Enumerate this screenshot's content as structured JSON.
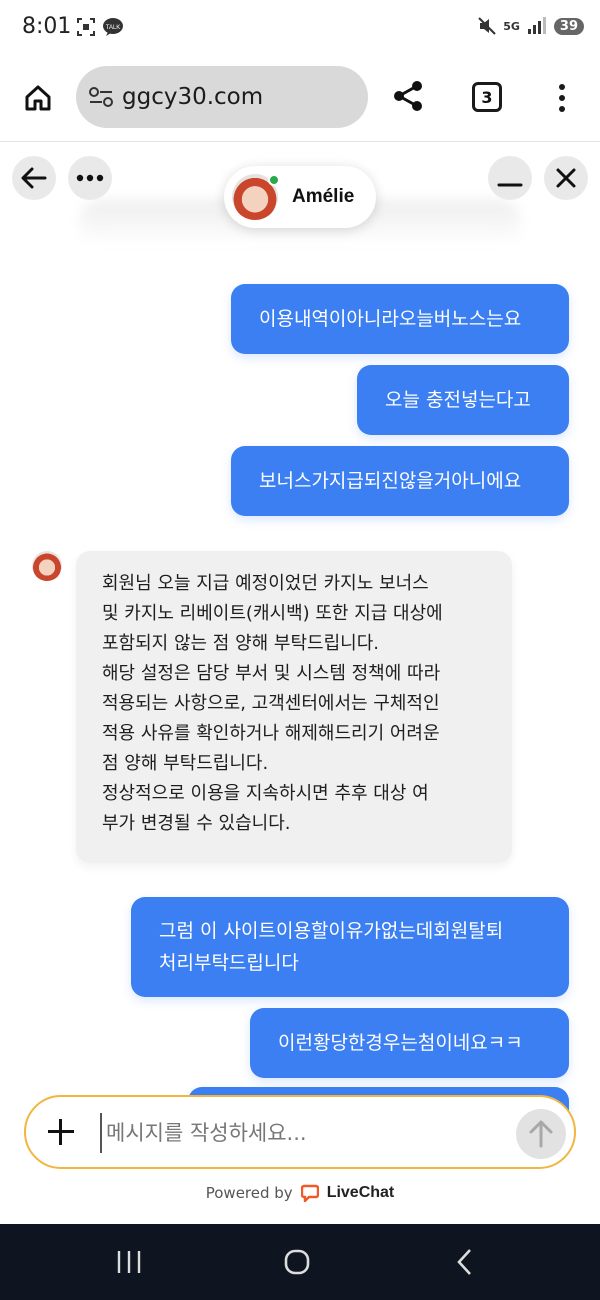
{
  "status_bar": {
    "time": "8:01",
    "battery": "39",
    "network": "5G"
  },
  "browser": {
    "url": "ggcy30.com",
    "tab_count": "3"
  },
  "chat": {
    "agent_name": "Amélie",
    "agent_status": "online",
    "messages": [
      {
        "from": "user",
        "text": "이용내역이아니라오늘버노스는요"
      },
      {
        "from": "user",
        "text": "오늘 충전넣는다고"
      },
      {
        "from": "user",
        "text": "보너스가지급되진않을거아니에요"
      },
      {
        "from": "agent",
        "text": "회원님 오늘 지급 예정이었던 카지노 보너스\n및 카지노 리베이트(캐시백) 또한 지급 대상에\n포함되지 않는 점 양해 부탁드립니다.\n해당 설정은 담당 부서 및 시스템 정책에 따라\n적용되는 사항으로, 고객센터에서는 구체적인\n적용 사유를 확인하거나 해제해드리기 어려운\n점 양해 부탁드립니다.\n정상적으로 이용을 지속하시면 추후 대상 여\n부가 변경될 수 있습니다."
      },
      {
        "from": "user",
        "text": "그럼 이 사이트이용할이유가없는데회원탈퇴\n처리부탁드립니다"
      },
      {
        "from": "user",
        "text": "이런황당한경우는첨이네요ㅋㅋ"
      }
    ]
  },
  "composer": {
    "placeholder": "메시지를 작성하세요..."
  },
  "footer": {
    "powered_by": "Powered by",
    "brand": "LiveChat",
    "brand_color": "#f05a28"
  },
  "colors": {
    "user_bubble": "#3b7ff2",
    "agent_bubble": "#f0f0f0",
    "composer_border": "#f0b640",
    "online": "#2aa84a"
  }
}
